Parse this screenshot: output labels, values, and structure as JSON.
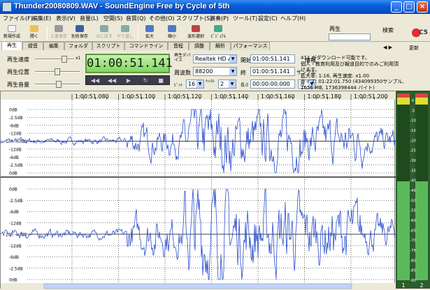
{
  "window": {
    "title": "Thunder20080809.WAV - SoundEngine Free by Cycle of 5th",
    "controls": [
      "_",
      "□",
      "×"
    ]
  },
  "menu": [
    "ファイル(F)",
    "編集(E)",
    "表示(V)",
    "音量(L)",
    "空間(S)",
    "音質(Q)",
    "その他(O)",
    "スクリプト(S)",
    "演奏(P)",
    "ツール(T)",
    "設定(C)",
    "ヘルプ(H)"
  ],
  "toolbar": [
    {
      "label": "新規作成",
      "icon": "new-file-icon",
      "color": "#f4f4f4",
      "disabled": false
    },
    {
      "label": "開く",
      "icon": "open-folder-icon",
      "color": "#e9c45b",
      "disabled": false
    },
    {
      "label": "上書保存",
      "icon": "save-icon",
      "color": "#888",
      "disabled": true
    },
    {
      "label": "別名保存",
      "icon": "save-as-icon",
      "color": "#3d5da8",
      "disabled": false
    },
    {
      "label": "元に戻す",
      "icon": "undo-icon",
      "color": "#8aa",
      "disabled": true
    },
    {
      "label": "やり直し",
      "icon": "redo-icon",
      "color": "#8aa",
      "disabled": true
    },
    {
      "label": "拡大",
      "icon": "zoom-in-icon",
      "color": "#4c7ac7",
      "disabled": false
    },
    {
      "label": "縮小",
      "icon": "zoom-out-icon",
      "color": "#4c7ac7",
      "disabled": false
    },
    {
      "label": "波形選択",
      "icon": "waveform-select-icon",
      "color": "#b44",
      "disabled": false
    },
    {
      "label": "ﾋﾞｼﾞｭｱﾙ",
      "icon": "visual-icon",
      "color": "#4a8",
      "disabled": false
    }
  ],
  "right_panel": {
    "label": "再生",
    "search_label": "検索",
    "update_label": "更新",
    "logo_text": "C5"
  },
  "tabs": [
    "再生",
    "録音",
    "編集",
    "フォルダ",
    "スクリプト",
    "コマンドライン",
    "音程",
    "調整",
    "解析",
    "パフォーマンス"
  ],
  "active_tab": 0,
  "controls": {
    "speed_label": "再生速度",
    "position_label": "再生位置",
    "volume_label": "再生音量",
    "speed_unit": "x1",
    "time_display": "01:00:51.141",
    "device_label": "再生デバイス",
    "device_value": "Realtek HD A",
    "freq_label": "周波数",
    "freq_value": "88200",
    "bit_label": "ﾋﾞｯﾄ",
    "bit_value": "16",
    "channel_label": "ﾁｬﾝﾈﾙ",
    "channel_value": "2",
    "start_label": "開始",
    "start_value": "01:00:51.141",
    "end_label": "終",
    "end_value": "01:00:51.141",
    "length_label": "長さ",
    "length_value": "00:00:00.000",
    "lr_value": "左",
    "info_label": "情報",
    "sample_label": "サンプル"
  },
  "info": {
    "lines": [
      "411 がダウンロード可能です。",
      "個人・教育利用及び報道目的でのみご利用頂",
      "けます。",
      "拡大率: 1:16, 再生速度: x1.00",
      "サイズ: 01:22:01.750 (434099350サンプル,",
      "1656 MB, 1736398444 バイト)"
    ]
  },
  "waveform": {
    "ruler_times": [
      "1:00:51.080",
      "1:00:51.100",
      "1:00:51.120",
      "1:00:51.140",
      "1:00:51.160",
      "1:00:51.180",
      "1:00:51.200"
    ],
    "ch1_labels": [
      "0dB",
      "-2.5dB",
      "-6dB",
      "-12dB",
      "1ch -infdB",
      "-12dB",
      "-6dB",
      "-2.5dB",
      "0dB"
    ],
    "ch2_labels": [
      "0dB",
      "-2.5dB",
      "-6dB",
      "-12dB",
      "2ch -infdB",
      "-12dB",
      "-6dB",
      "-2.5dB",
      "0dB"
    ],
    "colors": {
      "wave": "#2a4fd0",
      "grid": "#000",
      "ruler": "#ece9d8"
    }
  },
  "meters": {
    "scale": [
      "0",
      "-5",
      "-10",
      "-15",
      "-20",
      "-25",
      "-30",
      "-35",
      "-40",
      "-45",
      "-50",
      "-55",
      "-60",
      "-65",
      "-70",
      "-75",
      "-80",
      "-85",
      "-90"
    ],
    "channel_labels": [
      "1",
      "2"
    ],
    "peak_ch1": 0.55,
    "peak_ch2": 0.55
  }
}
